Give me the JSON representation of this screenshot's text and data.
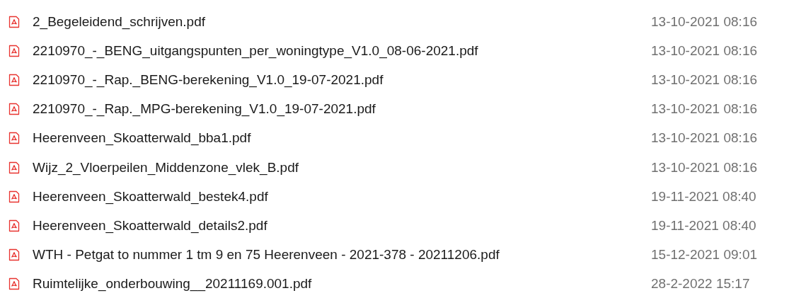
{
  "files": [
    {
      "name": "2_Begeleidend_schrijven.pdf",
      "modified": "13-10-2021 08:16"
    },
    {
      "name": "2210970_-_BENG_uitgangspunten_per_woningtype_V1.0_08-06-2021.pdf",
      "modified": "13-10-2021 08:16"
    },
    {
      "name": "2210970_-_Rap._BENG-berekening_V1.0_19-07-2021.pdf",
      "modified": "13-10-2021 08:16"
    },
    {
      "name": "2210970_-_Rap._MPG-berekening_V1.0_19-07-2021.pdf",
      "modified": "13-10-2021 08:16"
    },
    {
      "name": "Heerenveen_Skoatterwald_bba1.pdf",
      "modified": "13-10-2021 08:16"
    },
    {
      "name": "Wijz_2_Vloerpeilen_Middenzone_vlek_B.pdf",
      "modified": "13-10-2021 08:16"
    },
    {
      "name": "Heerenveen_Skoatterwald_bestek4.pdf",
      "modified": "19-11-2021 08:40"
    },
    {
      "name": "Heerenveen_Skoatterwald_details2.pdf",
      "modified": "19-11-2021 08:40"
    },
    {
      "name": "WTH - Petgat to nummer 1 tm 9 en 75 Heerenveen - 2021-378 - 20211206.pdf",
      "modified": "15-12-2021 09:01"
    },
    {
      "name": "Ruimtelijke_onderbouwing__20211169.001.pdf",
      "modified": "28-2-2022 15:17"
    }
  ]
}
